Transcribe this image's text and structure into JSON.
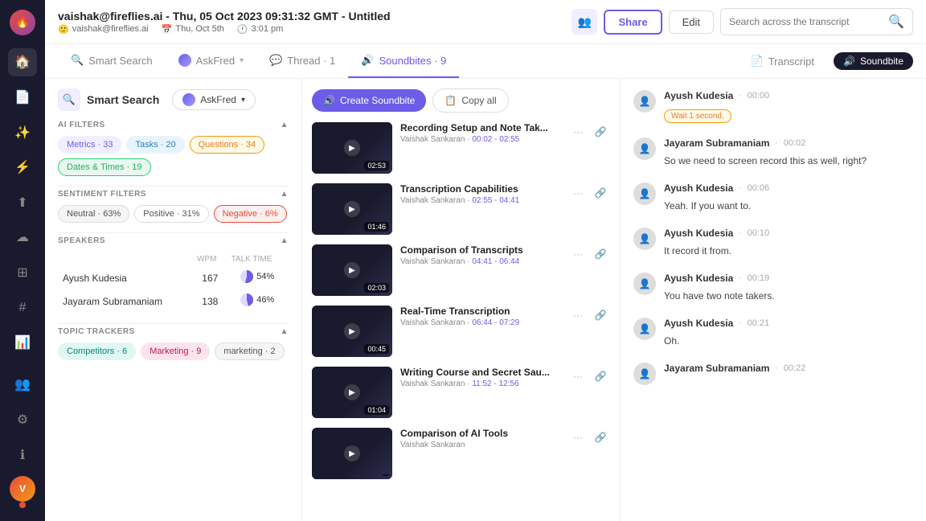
{
  "sidebar": {
    "nav_items": [
      {
        "icon": "🏠",
        "label": "home-icon",
        "active": false
      },
      {
        "icon": "📄",
        "label": "transcripts-icon",
        "active": false
      },
      {
        "icon": "🤖",
        "label": "ai-icon",
        "active": false
      },
      {
        "icon": "⚡",
        "label": "lightning-icon",
        "active": false
      },
      {
        "icon": "↑",
        "label": "upload-icon",
        "active": false
      },
      {
        "icon": "☁",
        "label": "cloud-icon",
        "active": false
      },
      {
        "icon": "⊞",
        "label": "grid-icon",
        "active": false
      },
      {
        "icon": "#",
        "label": "hashtag-icon",
        "active": false
      },
      {
        "icon": "📊",
        "label": "analytics-icon",
        "active": false
      },
      {
        "icon": "👥",
        "label": "people-icon",
        "active": false
      },
      {
        "icon": "⚙",
        "label": "settings-icon",
        "active": false
      },
      {
        "icon": "ℹ",
        "label": "info-icon",
        "active": false
      }
    ]
  },
  "header": {
    "title": "vaishak@fireflies.ai - Thu, 05 Oct 2023 09:31:32 GMT - Untitled",
    "user": "vaishak@fireflies.ai",
    "date": "Thu, Oct 5th",
    "time": "3:01 pm",
    "share_label": "Share",
    "edit_label": "Edit",
    "search_placeholder": "Search across the transcript"
  },
  "tabs": [
    {
      "label": "Smart Search",
      "icon": "🔍",
      "active": false
    },
    {
      "label": "AskFred",
      "icon": "🤖",
      "active": false
    },
    {
      "label": "Thread · 1",
      "icon": "💬",
      "active": false
    },
    {
      "label": "Soundbites · 9",
      "icon": "🔊",
      "active": true
    },
    {
      "label": "Transcript",
      "icon": "📄",
      "active": false
    }
  ],
  "soundbite_btn_label": "Soundbite",
  "filters": {
    "ai_section_label": "AI FILTERS",
    "tags": [
      {
        "label": "Metrics · 33",
        "type": "purple"
      },
      {
        "label": "Tasks · 20",
        "type": "blue"
      },
      {
        "label": "Questions · 34",
        "type": "orange"
      },
      {
        "label": "Dates & Times · 19",
        "type": "green"
      }
    ],
    "sentiment_section_label": "SENTIMENT FILTERS",
    "sentiment_tags": [
      {
        "label": "Neutral · 63%",
        "type": "neutral"
      },
      {
        "label": "Positive · 31%",
        "type": "positive"
      },
      {
        "label": "Negative · 6%",
        "type": "negative"
      }
    ],
    "speakers_section_label": "SPEAKERS",
    "speakers": [
      {
        "name": "Ayush Kudesia",
        "wpm": 167,
        "talk_time": "54%",
        "progress": 54
      },
      {
        "name": "Jayaram Subramaniam",
        "wpm": 138,
        "talk_time": "46%",
        "progress": 46
      }
    ],
    "topics_section_label": "TOPIC TRACKERS",
    "topic_tags": [
      {
        "label": "Competitors · 6",
        "type": "teal"
      },
      {
        "label": "Marketing · 9",
        "type": "pink"
      },
      {
        "label": "marketing · 2",
        "type": "neutral"
      }
    ]
  },
  "soundbites": {
    "create_label": "Create Soundbite",
    "copy_all_label": "Copy all",
    "items": [
      {
        "title": "Recording Setup and Note Tak...",
        "author": "Vaishak Sankaran",
        "time_range": "00:02 - 02:55",
        "duration": "02:53"
      },
      {
        "title": "Transcription Capabilities",
        "author": "Vaishak Sankaran",
        "time_range": "02:55 - 04:41",
        "duration": "01:46"
      },
      {
        "title": "Comparison of Transcripts",
        "author": "Vaishak Sankaran",
        "time_range": "04:41 - 06:44",
        "duration": "02:03"
      },
      {
        "title": "Real-Time Transcription",
        "author": "Vaishak Sankaran",
        "time_range": "06:44 - 07:29",
        "duration": "00:45"
      },
      {
        "title": "Writing Course and Secret Sau...",
        "author": "Vaishak Sankaran",
        "time_range": "11:52 - 12:56",
        "duration": "01:04"
      },
      {
        "title": "Comparison of AI Tools",
        "author": "Vaishak Sankaran",
        "time_range": "...",
        "duration": "..."
      }
    ]
  },
  "transcript": {
    "entries": [
      {
        "speaker": "Ayush Kudesia",
        "time": "00:00",
        "text": "Wait 1 second.",
        "badge": "Wait 1 second."
      },
      {
        "speaker": "Jayaram Subramaniam",
        "time": "00:02",
        "text": "So we need to screen record this as well, right?"
      },
      {
        "speaker": "Ayush Kudesia",
        "time": "00:06",
        "text": "Yeah. If you want to."
      },
      {
        "speaker": "Ayush Kudesia",
        "time": "00:10",
        "text": "It record it from."
      },
      {
        "speaker": "Ayush Kudesia",
        "time": "00:19",
        "text": "You have two note takers."
      },
      {
        "speaker": "Ayush Kudesia",
        "time": "00:21",
        "text": "Oh."
      },
      {
        "speaker": "Jayaram Subramaniam",
        "time": "00:22",
        "text": ""
      }
    ]
  }
}
